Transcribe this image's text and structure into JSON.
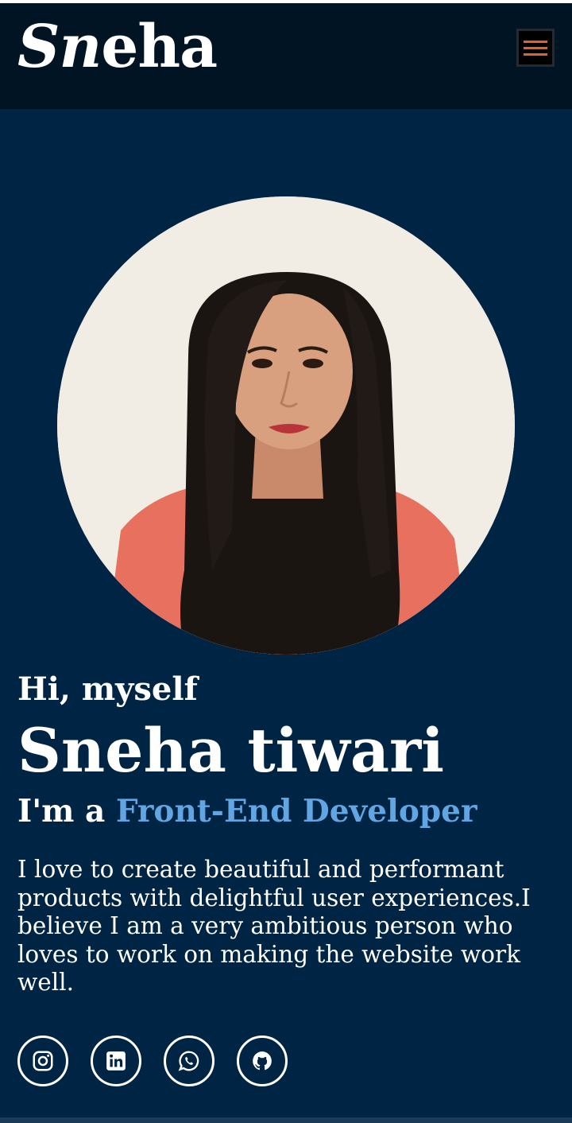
{
  "header": {
    "logo_first": "Sn",
    "logo_rest": "eha",
    "menu_icon": "hamburger-menu-icon"
  },
  "profile": {
    "photo_icon": "profile-photo"
  },
  "hero": {
    "greeting": "Hi, myself",
    "name": "Sneha tiwari",
    "role_prefix": "I'm a",
    "role_highlight": "Front-End Developer",
    "bio": "I love to create beautiful and performant products with delightful user experiences.I believe I am a very ambitious person who loves to work on making the website work well."
  },
  "socials": [
    {
      "icon": "instagram-icon"
    },
    {
      "icon": "linkedin-icon"
    },
    {
      "icon": "whatsapp-icon"
    },
    {
      "icon": "github-icon"
    }
  ],
  "colors": {
    "background": "#002444",
    "header": "#011423",
    "accent": "#62a5e3",
    "menu_accent": "#e0622f"
  }
}
